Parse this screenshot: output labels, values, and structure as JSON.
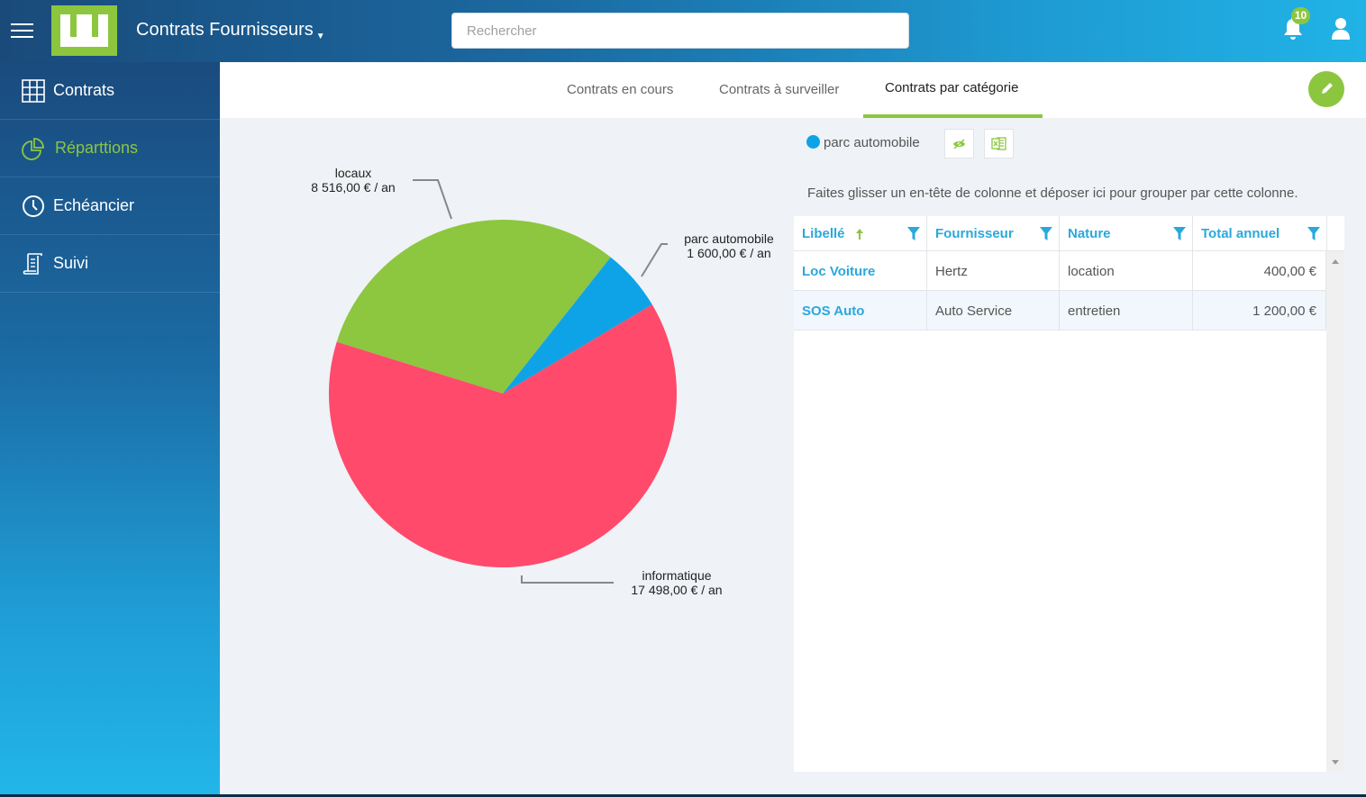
{
  "header": {
    "app_title": "Contrats Fournisseurs",
    "search_placeholder": "Rechercher",
    "notification_count": "10",
    "icons": {
      "menu": "hamburger-icon",
      "notifications": "bell-icon",
      "user": "user-icon"
    }
  },
  "sidebar": {
    "items": [
      {
        "label": "Contrats",
        "icon": "grid-icon",
        "active": false
      },
      {
        "label": "Réparttions",
        "icon": "pie-chart-icon",
        "active": true
      },
      {
        "label": "Echéancier",
        "icon": "clock-icon",
        "active": false
      },
      {
        "label": "Suivi",
        "icon": "scroll-icon",
        "active": false
      }
    ]
  },
  "tabs": [
    {
      "label": "Contrats en cours",
      "active": false
    },
    {
      "label": "Contrats à surveiller",
      "active": false
    },
    {
      "label": "Contrats par catégorie",
      "active": true
    }
  ],
  "colors": {
    "accent_green": "#8cc63f",
    "link_blue": "#2aa8dc",
    "slice_locaux": "#8dc63f",
    "slice_parc_automobile": "#0ea3e6",
    "slice_informatique": "#ff4a6b"
  },
  "chart_data": {
    "type": "pie",
    "title": "",
    "unit": "€ / an",
    "slices": [
      {
        "label": "locaux",
        "value": 8516.0,
        "display": "8 516,00 € / an",
        "color": "#8dc63f"
      },
      {
        "label": "parc automobile",
        "value": 1600.0,
        "display": "1 600,00 € / an",
        "color": "#0ea3e6"
      },
      {
        "label": "informatique",
        "value": 17498.0,
        "display": "17 498,00 € / an",
        "color": "#ff4a6b"
      }
    ],
    "legend": "none"
  },
  "detail": {
    "selected_category": "parc automobile",
    "group_hint": "Faites glisser un en-tête de colonne et déposer ici pour grouper par cette colonne.",
    "columns": [
      "Libellé",
      "Fournisseur",
      "Nature",
      "Total annuel"
    ],
    "sort_column": "Libellé",
    "sort_direction": "ascending",
    "rows": [
      [
        "Loc Voiture",
        "Hertz",
        "location",
        "400,00 €"
      ],
      [
        "SOS Auto",
        "Auto Service",
        "entretien",
        "1 200,00 €"
      ]
    ],
    "tools": [
      {
        "icon": "hide-eye-icon"
      },
      {
        "icon": "excel-export-icon"
      }
    ]
  }
}
